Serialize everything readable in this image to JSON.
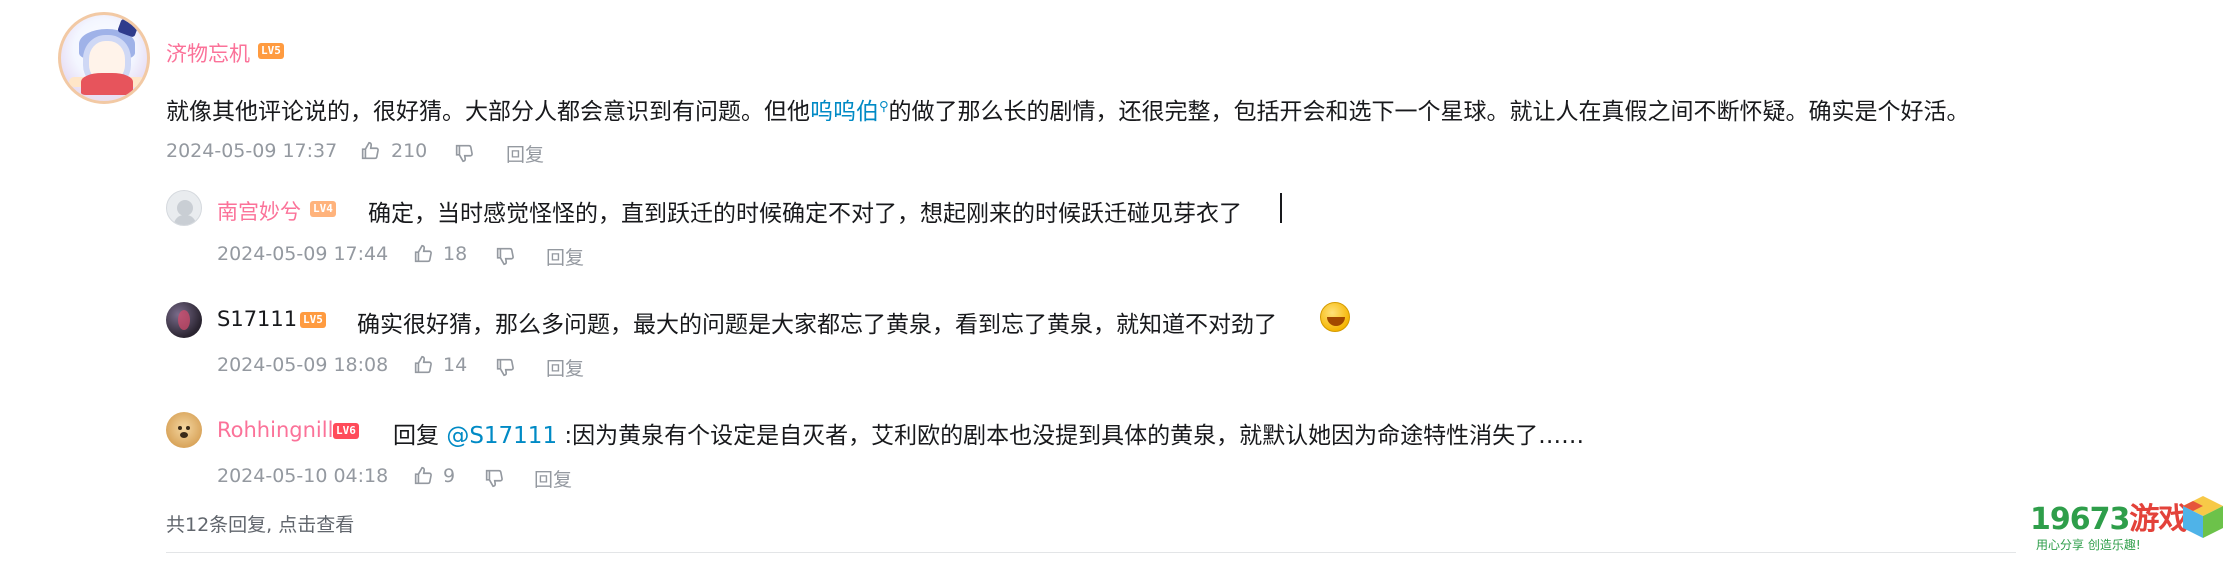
{
  "comment": {
    "username": "济物忘机",
    "level": "LV5",
    "text_before": "就像其他评论说的，很好猜。大部分人都会意识到有问题。但他",
    "link_text": "呜呜伯",
    "text_after": "的做了那么长的剧情，还很完整，包括开会和选下一个星球。就让人在真假之间不断怀疑。确实是个好活。",
    "timestamp": "2024-05-09 17:37",
    "likes": "210",
    "reply_label": "回复"
  },
  "replies": [
    {
      "username": "南宫妙兮",
      "level": "LV4",
      "text": "确定，当时感觉怪怪的，直到跃迁的时候确定不对了，想起刚来的时候跃迁碰见芽衣了",
      "timestamp": "2024-05-09 17:44",
      "likes": "18",
      "reply_label": "回复"
    },
    {
      "username": "S17111",
      "level": "LV5",
      "text": "确实很好猜，那么多问题，最大的问题是大家都忘了黄泉，看到忘了黄泉，就知道不对劲了",
      "timestamp": "2024-05-09 18:08",
      "likes": "14",
      "reply_label": "回复"
    },
    {
      "username": "Rohhingnill",
      "level": "LV6",
      "reply_prefix": "回复",
      "mention": "@S17111",
      "text": ":因为黄泉有个设定是自灭者，艾利欧的剧本也没提到具体的黄泉，就默认她因为命途特性消失了……",
      "timestamp": "2024-05-10 04:18",
      "likes": "9",
      "reply_label": "回复"
    }
  ],
  "footer": {
    "more_replies": "共12条回复, 点击查看"
  },
  "watermark": {
    "brand_num": "19673",
    "brand_word": "游戏",
    "slogan": "用心分享 创造乐趣!"
  },
  "colors": {
    "username_pink": "#fb7299",
    "link_blue": "#008ac5",
    "meta_gray": "#9499a0",
    "text": "#18191c"
  }
}
